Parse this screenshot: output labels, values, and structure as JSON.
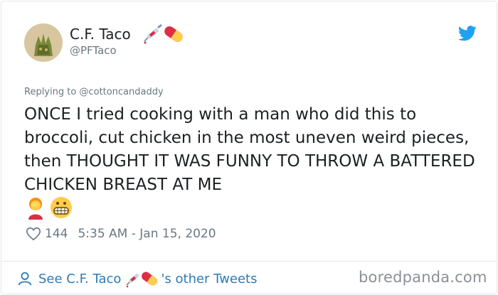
{
  "tweet": {
    "display_name": "C.F. Taco",
    "handle": "@PFTaco",
    "reply_to": "Replying to @cottoncandaddy",
    "text": "ONCE I tried cooking with a man who did this to broccoli, cut chicken in the most uneven weird pieces, then THOUGHT IT WAS FUNNY TO THROW A BATTERED CHICKEN BREAST AT ME",
    "name_emojis": [
      "syringe-icon",
      "pill-icon"
    ],
    "body_emojis": [
      "facepalm-woman-icon",
      "grimacing-face-icon"
    ],
    "likes": "144",
    "timestamp": "5:35 AM - Jan 15, 2020"
  },
  "footer": {
    "see_prefix": "See C.F. Taco",
    "see_suffix": "'s other Tweets"
  },
  "watermark": "boredpanda.com",
  "colors": {
    "twitter_blue": "#1da1f2",
    "link_blue": "#2b7bb9",
    "muted_gray": "#697882",
    "text_dark": "#1c2022"
  }
}
